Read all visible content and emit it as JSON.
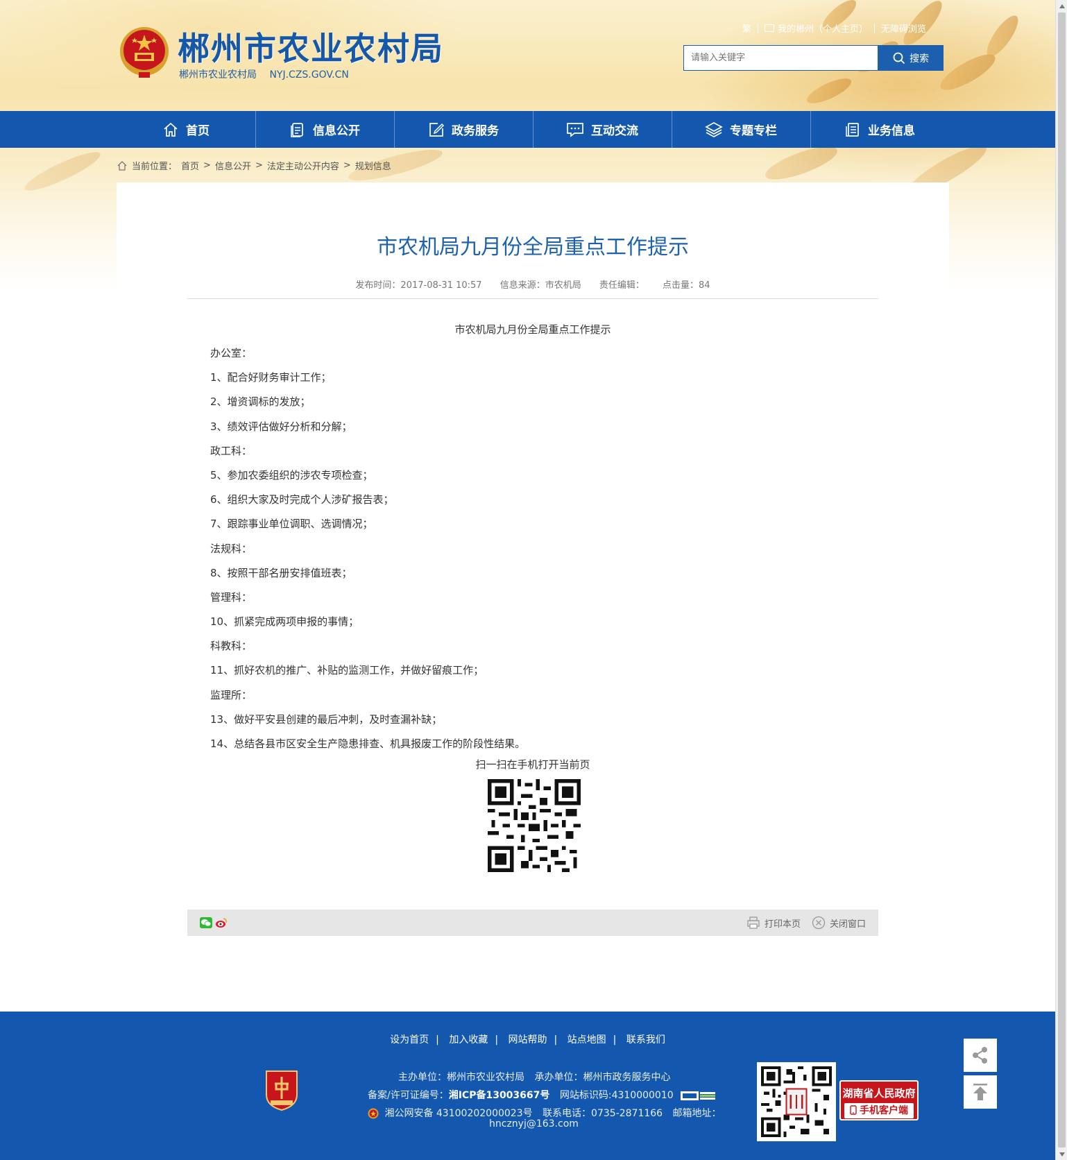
{
  "header": {
    "title": "郴州市农业农村局",
    "subtitle_cn": "郴州市农业农村局",
    "subtitle_domain": "NYJ.CZS.GOV.CN",
    "toplinks": {
      "trad": "繁",
      "mycity": "我的郴州（个人主页）",
      "accessible": "无障碍浏览"
    },
    "search": {
      "placeholder": "请输入关键字",
      "button": "搜索"
    }
  },
  "nav": [
    {
      "label": "首页",
      "icon": "home-icon"
    },
    {
      "label": "信息公开",
      "icon": "document-icon"
    },
    {
      "label": "政务服务",
      "icon": "edit-icon"
    },
    {
      "label": "互动交流",
      "icon": "chat-icon"
    },
    {
      "label": "专题专栏",
      "icon": "layers-icon"
    },
    {
      "label": "业务信息",
      "icon": "file-list-icon"
    }
  ],
  "breadcrumb": {
    "prefix": "当前位置：",
    "items": [
      "首页",
      "信息公开",
      "法定主动公开内容",
      "规划信息"
    ]
  },
  "article": {
    "title": "市农机局九月份全局重点工作提示",
    "meta": {
      "published": "发布时间：2017-08-31 10:57",
      "source": "信息来源：市农机局",
      "editor": "责任编辑：",
      "hits": "点击量：84"
    },
    "heading": "市农机局九月份全局重点工作提示",
    "lines": [
      "办公室：",
      "1、配合好财务审计工作；",
      "2、增资调标的发放；",
      "3、绩效评估做好分析和分解；",
      "政工科：",
      "5、参加农委组织的涉农专项检查；",
      "6、组织大家及时完成个人涉矿报告表；",
      "7、跟踪事业单位调职、选调情况；",
      "法规科：",
      "8、按照干部名册安排值班表；",
      "管理科：",
      "10、抓紧完成两项申报的事情；",
      "科教科：",
      "11、抓好农机的推广、补贴的监测工作，并做好留痕工作；",
      "监理所：",
      "13、做好平安县创建的最后冲刺，及时查漏补缺；",
      "14、总结各县市区安全生产隐患排查、机具报废工作的阶段性结果。"
    ],
    "scan_text": "扫一扫在手机打开当前页"
  },
  "share_bar": {
    "print": "打印本页",
    "close": "关闭窗口"
  },
  "footer": {
    "links": [
      "设为首页",
      "加入收藏",
      "网站帮助",
      "站点地图",
      "联系我们"
    ],
    "sponsor": "主办单位：郴州市农业农村局",
    "undertaker": "承办单位：郴州市政务服务中心",
    "icp_label": "备案/许可证编号：",
    "icp": "湘ICP备13003667号",
    "site_id": "网站标识码:4310000010",
    "police": "湘公网安备 43100202000023号",
    "phone": "联系电话：0735-2871166",
    "email_label": "邮箱地址：",
    "email": "hncznyj@163.com",
    "app_badge": {
      "line1": "湖南省人民政府",
      "line2": "手机客户端"
    }
  },
  "colors": {
    "primary": "#1358ae",
    "title_blue": "#1d62ae",
    "badge_red": "#c8151c"
  }
}
